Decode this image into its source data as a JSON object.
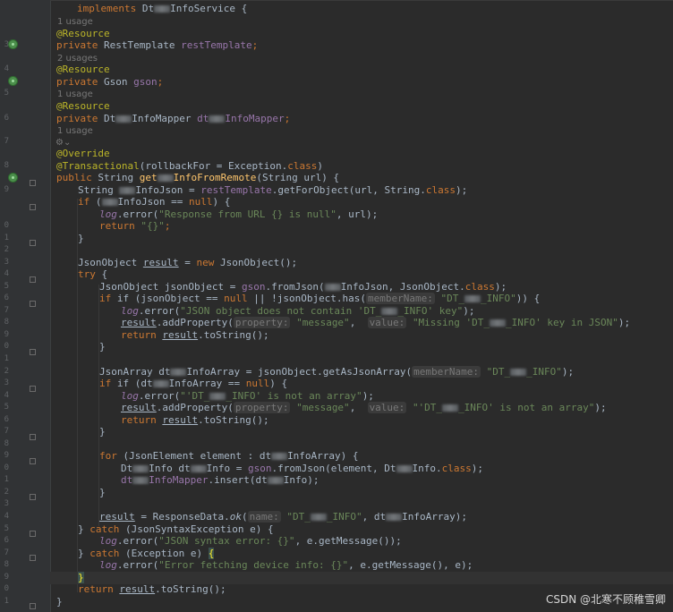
{
  "editor": {
    "gutter_numbers": [
      "",
      "",
      "",
      "3",
      "",
      "4",
      "",
      "5",
      "",
      "6",
      "",
      "7",
      "",
      "8",
      "",
      "9",
      "",
      "",
      "0",
      "1",
      "2",
      "3",
      "4",
      "5",
      "6",
      "7",
      "8",
      "9",
      "0",
      "1",
      "2",
      "3",
      "4",
      "5",
      "6",
      "7",
      "8",
      "9",
      "0",
      "1",
      "2",
      "3",
      "4",
      "5",
      "6",
      "7",
      "8",
      "9",
      "0",
      "1",
      "2",
      "3",
      "4"
    ],
    "usages": [
      "1 usage",
      "2 usages",
      "1 usage",
      "1 usage"
    ],
    "code": {
      "l0": "implements",
      "l0b": "Dt",
      "l0c": "InfoService {",
      "resource": "@Resource",
      "private": "private",
      "rest_type": "RestTemplate",
      "rest_field": "restTemplate",
      "gson_type": "Gson",
      "gson_field": "gson",
      "mapper_type_a": "Dt",
      "mapper_type_b": "InfoMapper",
      "mapper_field_a": "dt",
      "mapper_field_b": "InfoMapper",
      "override": "@Override",
      "transactional": "@Transactional",
      "tx_args_a": "(rollbackFor = Exception.",
      "tx_args_class": "class",
      "tx_args_end": ")",
      "public": "public",
      "string": "String",
      "method_a": "get",
      "method_b": "InfoFromRemote",
      "method_params": "(String url) {",
      "line_json_a": "String",
      "line_json_b": "InfoJson = ",
      "line_json_c": ".getForObject(url, String.",
      "line_json_d": ");",
      "if_open": "if (",
      "if_mid": "InfoJson == ",
      "null": "null",
      "if_close": ") {",
      "log": "log",
      "error_call": ".error(",
      "msg_null": "\"Response from URL {} is null\"",
      "msg_null_tail": ", url);",
      "return": "return",
      "empty_json": "\"{}\"",
      "semi": ";",
      "close_brace": "}",
      "jo_decl": "JsonObject ",
      "result": "result",
      "jo_new": " = ",
      "new": "new",
      "jo_ctor": " JsonObject();",
      "try": "try",
      "open_brace": " {",
      "jo_obj_decl": "JsonObject jsonObject = ",
      "from_json": ".fromJson(",
      "from_json_tail": "InfoJson, JsonObject.",
      "class_end": ");",
      "if_has_a": "if (jsonObject == ",
      "if_has_b": " || !jsonObject.has(",
      "hint_member": "memberName:",
      "dt_info_key_a": "\"DT_",
      "dt_info_key_b": "_INFO\"",
      "if_has_end": ")) {",
      "msg_no_key_a": "\"JSON object does not contain 'DT_",
      "msg_no_key_b": "_INFO' key\"",
      "add_prop": ".addProperty(",
      "hint_property": "property:",
      "message_key": "\"message\"",
      "hint_value": "value:",
      "missing_a": "\"Missing 'DT_",
      "missing_b": "_INFO' key in JSON\"",
      "return_result": ".toString();",
      "ja_decl_a": "JsonArray dt",
      "ja_decl_b": "InfoArray = jsonObject.getAsJsonArray(",
      "if_arr_a": "if (dt",
      "if_arr_b": "InfoArray == ",
      "msg_not_arr_a": "\"'DT_",
      "msg_not_arr_b": "_INFO' is not an array\"",
      "not_arr_val_a": "\"'DT_",
      "not_arr_val_b": "_INFO' is not an array\"",
      "for_a": "for",
      "for_b": " (JsonElement element : dt",
      "for_c": "InfoArray) {",
      "dt_info_a": "Dt",
      "dt_info_b": "Info dt",
      "dt_info_c": "Info = ",
      "dt_info_d": ".fromJson(element, Dt",
      "dt_info_e": "Info.",
      "mapper_insert_a": "dt",
      "mapper_insert_b": "InfoMapper",
      "mapper_insert_c": ".insert(dt",
      "mapper_insert_d": "Info);",
      "rd_a": " = ResponseData.",
      "rd_ok": "ok",
      "rd_b": "(",
      "hint_name": "name:",
      "rd_c": ", dt",
      "rd_d": "InfoArray);",
      "catch": "catch",
      "catch_syntax": " (JsonSyntaxException e) {",
      "msg_syntax": "\"JSON syntax error: {}\"",
      "msg_syntax_tail": ", e.getMessage());",
      "catch_ex": " (Exception e) ",
      "msg_fetch": "\"Error fetching device info: {}\"",
      "msg_fetch_tail": ", e.getMessage(), e);",
      "brace_hl": "{",
      "brace_hl_close": "}",
      "final_return_tail": ".toString();",
      "lens_icon": "⚙⌄"
    }
  },
  "watermark": "CSDN @北寒不顾稚雪卿"
}
